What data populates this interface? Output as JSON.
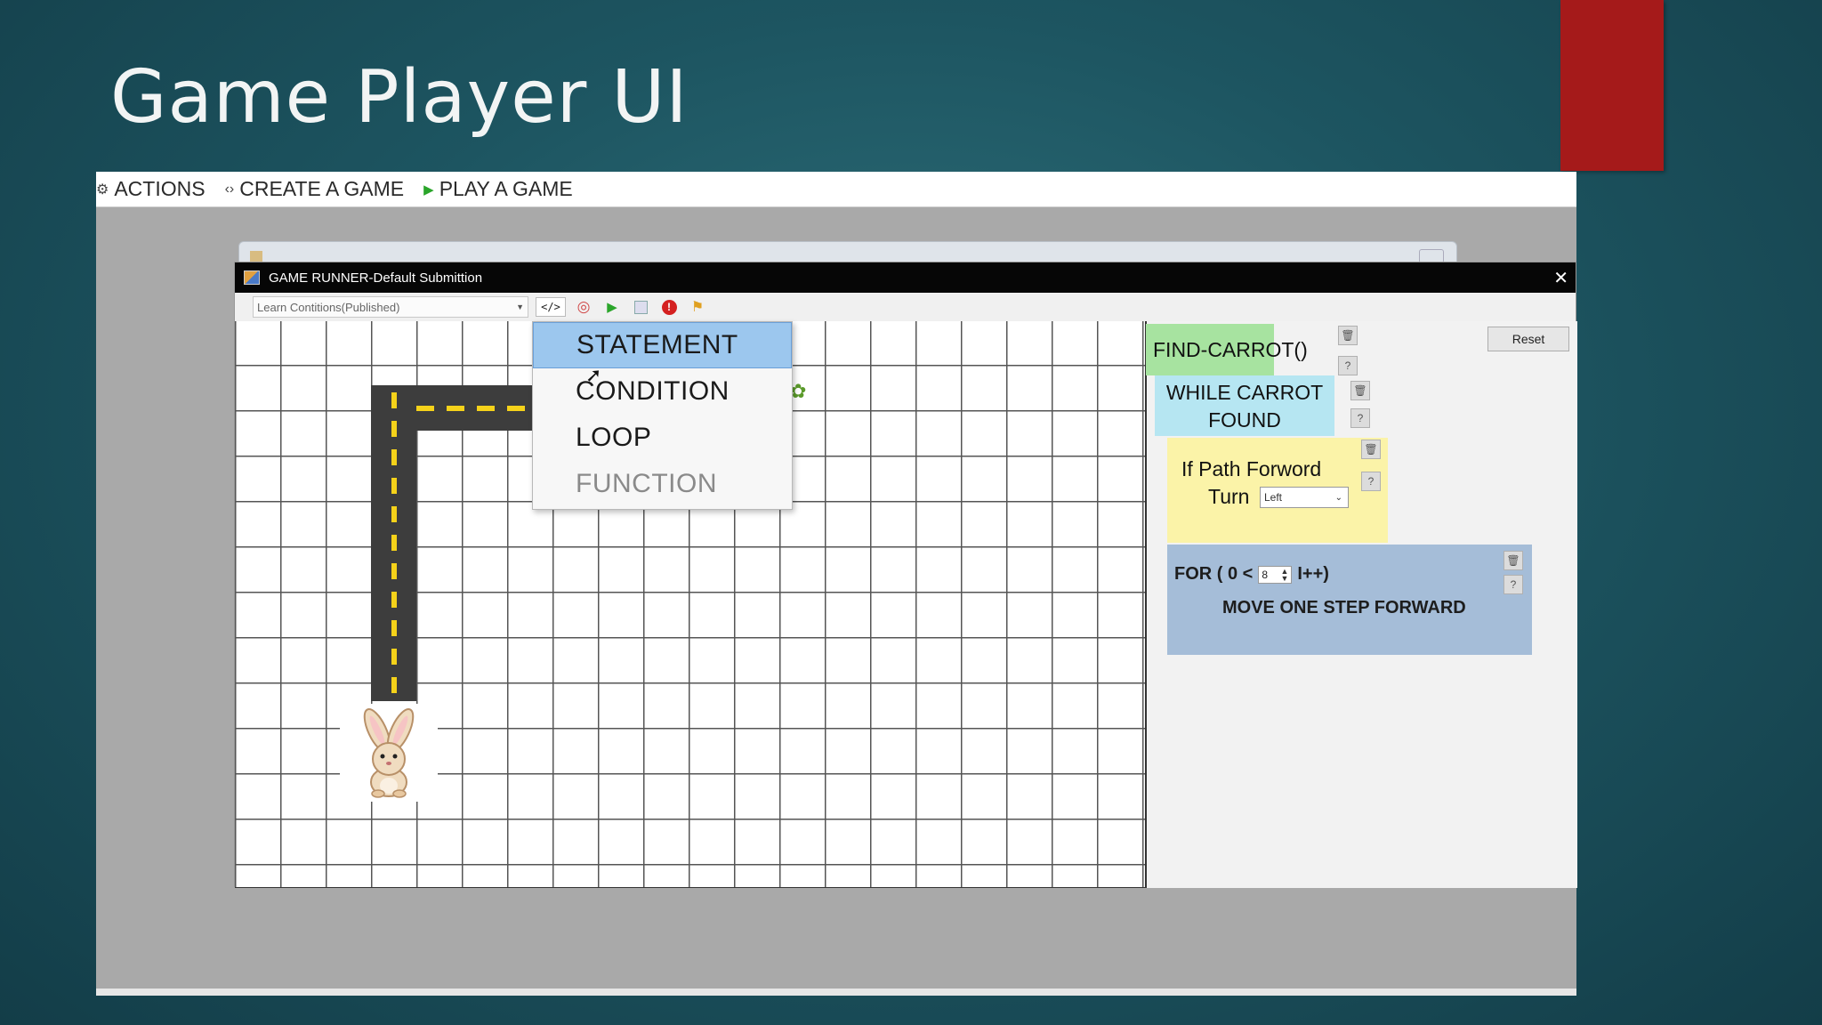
{
  "slide": {
    "title": "Game Player UI",
    "accent_color": "#a51a1a"
  },
  "menubar": {
    "items": [
      {
        "icon": "gear-icon",
        "label": "ACTIONS"
      },
      {
        "icon": "code-icon",
        "label": "CREATE A GAME"
      },
      {
        "icon": "play-icon",
        "label": "PLAY A GAME"
      }
    ]
  },
  "runner": {
    "title": "GAME RUNNER-Default Submittion",
    "game_select": "Learn Contitions(Published)",
    "toolbar": {
      "code_label": "</>",
      "icons": [
        "code-dropdown-icon",
        "target-icon",
        "run-icon",
        "save-icon",
        "stop-icon",
        "clean-icon"
      ]
    },
    "reset_label": "Reset"
  },
  "statement_menu": {
    "items": [
      {
        "label": "STATEMENT",
        "state": "active"
      },
      {
        "label": "CONDITION",
        "state": "normal"
      },
      {
        "label": "LOOP",
        "state": "normal"
      },
      {
        "label": "FUNCTION",
        "state": "disabled"
      }
    ]
  },
  "blocks": {
    "find_carrot": "FIND-CARROT()",
    "while_line1": "WHILE CARROT",
    "while_line2": "FOUND",
    "if_line1": "If Path Forword",
    "if_line2": "Turn",
    "if_turn_value": "Left",
    "for_prefix": "FOR ( 0 <",
    "for_count": "8",
    "for_suffix": "I++)",
    "for_body": "MOVE ONE STEP FORWARD"
  },
  "colors": {
    "find_block": "#a7e3a0",
    "while_block": "#b6e6f2",
    "if_block": "#fbf3a8",
    "for_block": "#a5bdd8",
    "road": "#3d3d3d",
    "road_dash": "#f5d21a"
  }
}
